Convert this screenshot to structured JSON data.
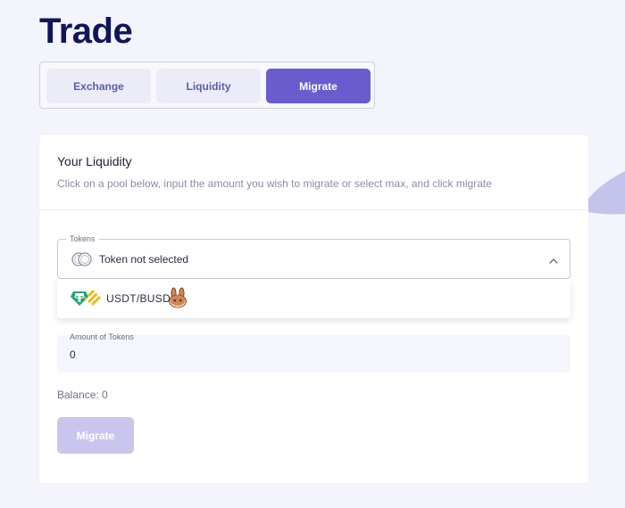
{
  "page": {
    "title": "Trade"
  },
  "tabs": [
    {
      "label": "Exchange",
      "active": false
    },
    {
      "label": "Liquidity",
      "active": false
    },
    {
      "label": "Migrate",
      "active": true
    }
  ],
  "card": {
    "title": "Your Liquidity",
    "subtitle": "Click on a pool below, input the amount you wish to migrate or select max, and click migrate"
  },
  "token_select": {
    "label": "Tokens",
    "value": "Token not selected",
    "icon": "coins-icon",
    "expanded": true,
    "options": [
      {
        "label": "USDT/BUSD",
        "icons": [
          "tether-icon",
          "busd-icon",
          "pancakeswap-bunny-icon"
        ]
      }
    ]
  },
  "amount": {
    "label": "Amount of Tokens",
    "value": "0"
  },
  "balance": {
    "text": "Balance: 0"
  },
  "actions": {
    "migrate_label": "Migrate",
    "migrate_enabled": false
  },
  "colors": {
    "accent": "#6a5ccf",
    "accent_disabled": "#c9c5ec",
    "title": "#12155a",
    "tab_inactive_bg": "#ebecf7",
    "background": "#f4f5fc",
    "tether_green": "#26a17b",
    "busd_yellow": "#f0b90b",
    "bunny_brown": "#d1884f"
  }
}
